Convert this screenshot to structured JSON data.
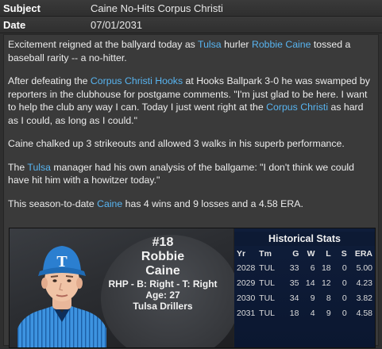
{
  "header": {
    "subject_label": "Subject",
    "subject_value": "Caine No-Hits Corpus Christi",
    "date_label": "Date",
    "date_value": "07/01/2031"
  },
  "article": {
    "p1": [
      {
        "text": "Excitement reigned at the ballyard today as "
      },
      {
        "text": "Tulsa",
        "link": true
      },
      {
        "text": " hurler "
      },
      {
        "text": "Robbie Caine",
        "link": true
      },
      {
        "text": " tossed a baseball rarity -- a no-hitter."
      }
    ],
    "p2": [
      {
        "text": "After defeating the "
      },
      {
        "text": "Corpus Christi Hooks",
        "link": true
      },
      {
        "text": " at Hooks Ballpark 3-0 he was swamped by reporters in the clubhouse for postgame comments. \"I'm just glad to be here. I want to help the club any way I can. Today I just went right at the "
      },
      {
        "text": "Corpus Christi",
        "link": true
      },
      {
        "text": " as hard as I could, as long as I could.\""
      }
    ],
    "p3": [
      {
        "text": "Caine chalked up 3 strikeouts and allowed 3 walks in his superb performance."
      }
    ],
    "p4": [
      {
        "text": "The "
      },
      {
        "text": "Tulsa",
        "link": true
      },
      {
        "text": " manager had his own analysis of the ballgame: \"I don't think we could have hit him with a howitzer today.\""
      }
    ],
    "p5": [
      {
        "text": "This season-to-date "
      },
      {
        "text": "Caine",
        "link": true
      },
      {
        "text": " has 4 wins and 9 losses and a 4.58 ERA."
      }
    ]
  },
  "player": {
    "number": "#18",
    "first_name": "Robbie",
    "last_name": "Caine",
    "bio": "RHP - B: Right - T: Right",
    "age": "Age: 27",
    "team": "Tulsa Drillers",
    "cap_letter": "T"
  },
  "stats": {
    "title": "Historical Stats",
    "columns": [
      "Yr",
      "Tm",
      "G",
      "W",
      "L",
      "S",
      "ERA"
    ],
    "rows": [
      [
        "2028",
        "TUL",
        "33",
        "6",
        "18",
        "0",
        "5.00"
      ],
      [
        "2029",
        "TUL",
        "35",
        "14",
        "12",
        "0",
        "4.23"
      ],
      [
        "2030",
        "TUL",
        "34",
        "9",
        "8",
        "0",
        "3.82"
      ],
      [
        "2031",
        "TUL",
        "18",
        "4",
        "9",
        "0",
        "4.58"
      ]
    ]
  },
  "colors": {
    "link": "#58b4f0",
    "stats_bg": "#0f1d3a",
    "jersey": "#2b7fd0"
  }
}
